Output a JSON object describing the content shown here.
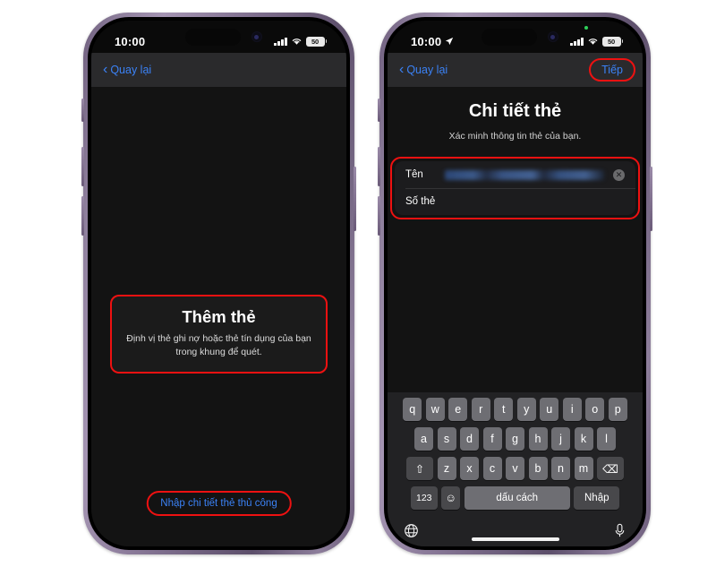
{
  "phones": [
    {
      "id": "phone-scan",
      "status": {
        "time": "10:00",
        "location_arrow": false,
        "battery": "50"
      },
      "nav": {
        "back_label": "Quay lại",
        "next_label": null
      },
      "scan_card": {
        "title": "Thêm thẻ",
        "subtitle": "Định vị thẻ ghi nợ hoặc thẻ tín dụng của bạn trong khung để quét."
      },
      "manual_button": "Nhập chi tiết thẻ thủ công"
    },
    {
      "id": "phone-details",
      "status": {
        "time": "10:00",
        "location_arrow": true,
        "battery": "50"
      },
      "nav": {
        "back_label": "Quay lại",
        "next_label": "Tiếp"
      },
      "page_title": "Chi tiết thẻ",
      "page_subtitle": "Xác minh thông tin thẻ của bạn.",
      "form": {
        "rows": [
          {
            "label": "Tên",
            "value": "",
            "redacted": true,
            "has_clear": true
          },
          {
            "label": "Số thẻ",
            "value": "",
            "redacted": false,
            "has_clear": false
          }
        ]
      },
      "keyboard": {
        "row1": [
          "q",
          "w",
          "e",
          "r",
          "t",
          "y",
          "u",
          "i",
          "o",
          "p"
        ],
        "row2": [
          "a",
          "s",
          "d",
          "f",
          "g",
          "h",
          "j",
          "k",
          "l"
        ],
        "row3": [
          "z",
          "x",
          "c",
          "v",
          "b",
          "n",
          "m"
        ],
        "shift_icon": "⇧",
        "backspace_icon": "⌫",
        "numbers_key": "123",
        "emoji_icon": "☺",
        "space_key": "dấu cách",
        "return_key": "Nhập",
        "globe_icon": "🌐",
        "mic_icon": "🎤"
      }
    }
  ],
  "colors": {
    "accent_blue": "#3b82f6",
    "highlight_red": "#ee1111",
    "screen_bg": "#131313",
    "navbar_bg": "#2a2a2c",
    "card_bg": "#1c1c1e",
    "keyboard_bg": "#222224",
    "key_bg": "#6e6e73",
    "key_dark_bg": "#48484b"
  }
}
